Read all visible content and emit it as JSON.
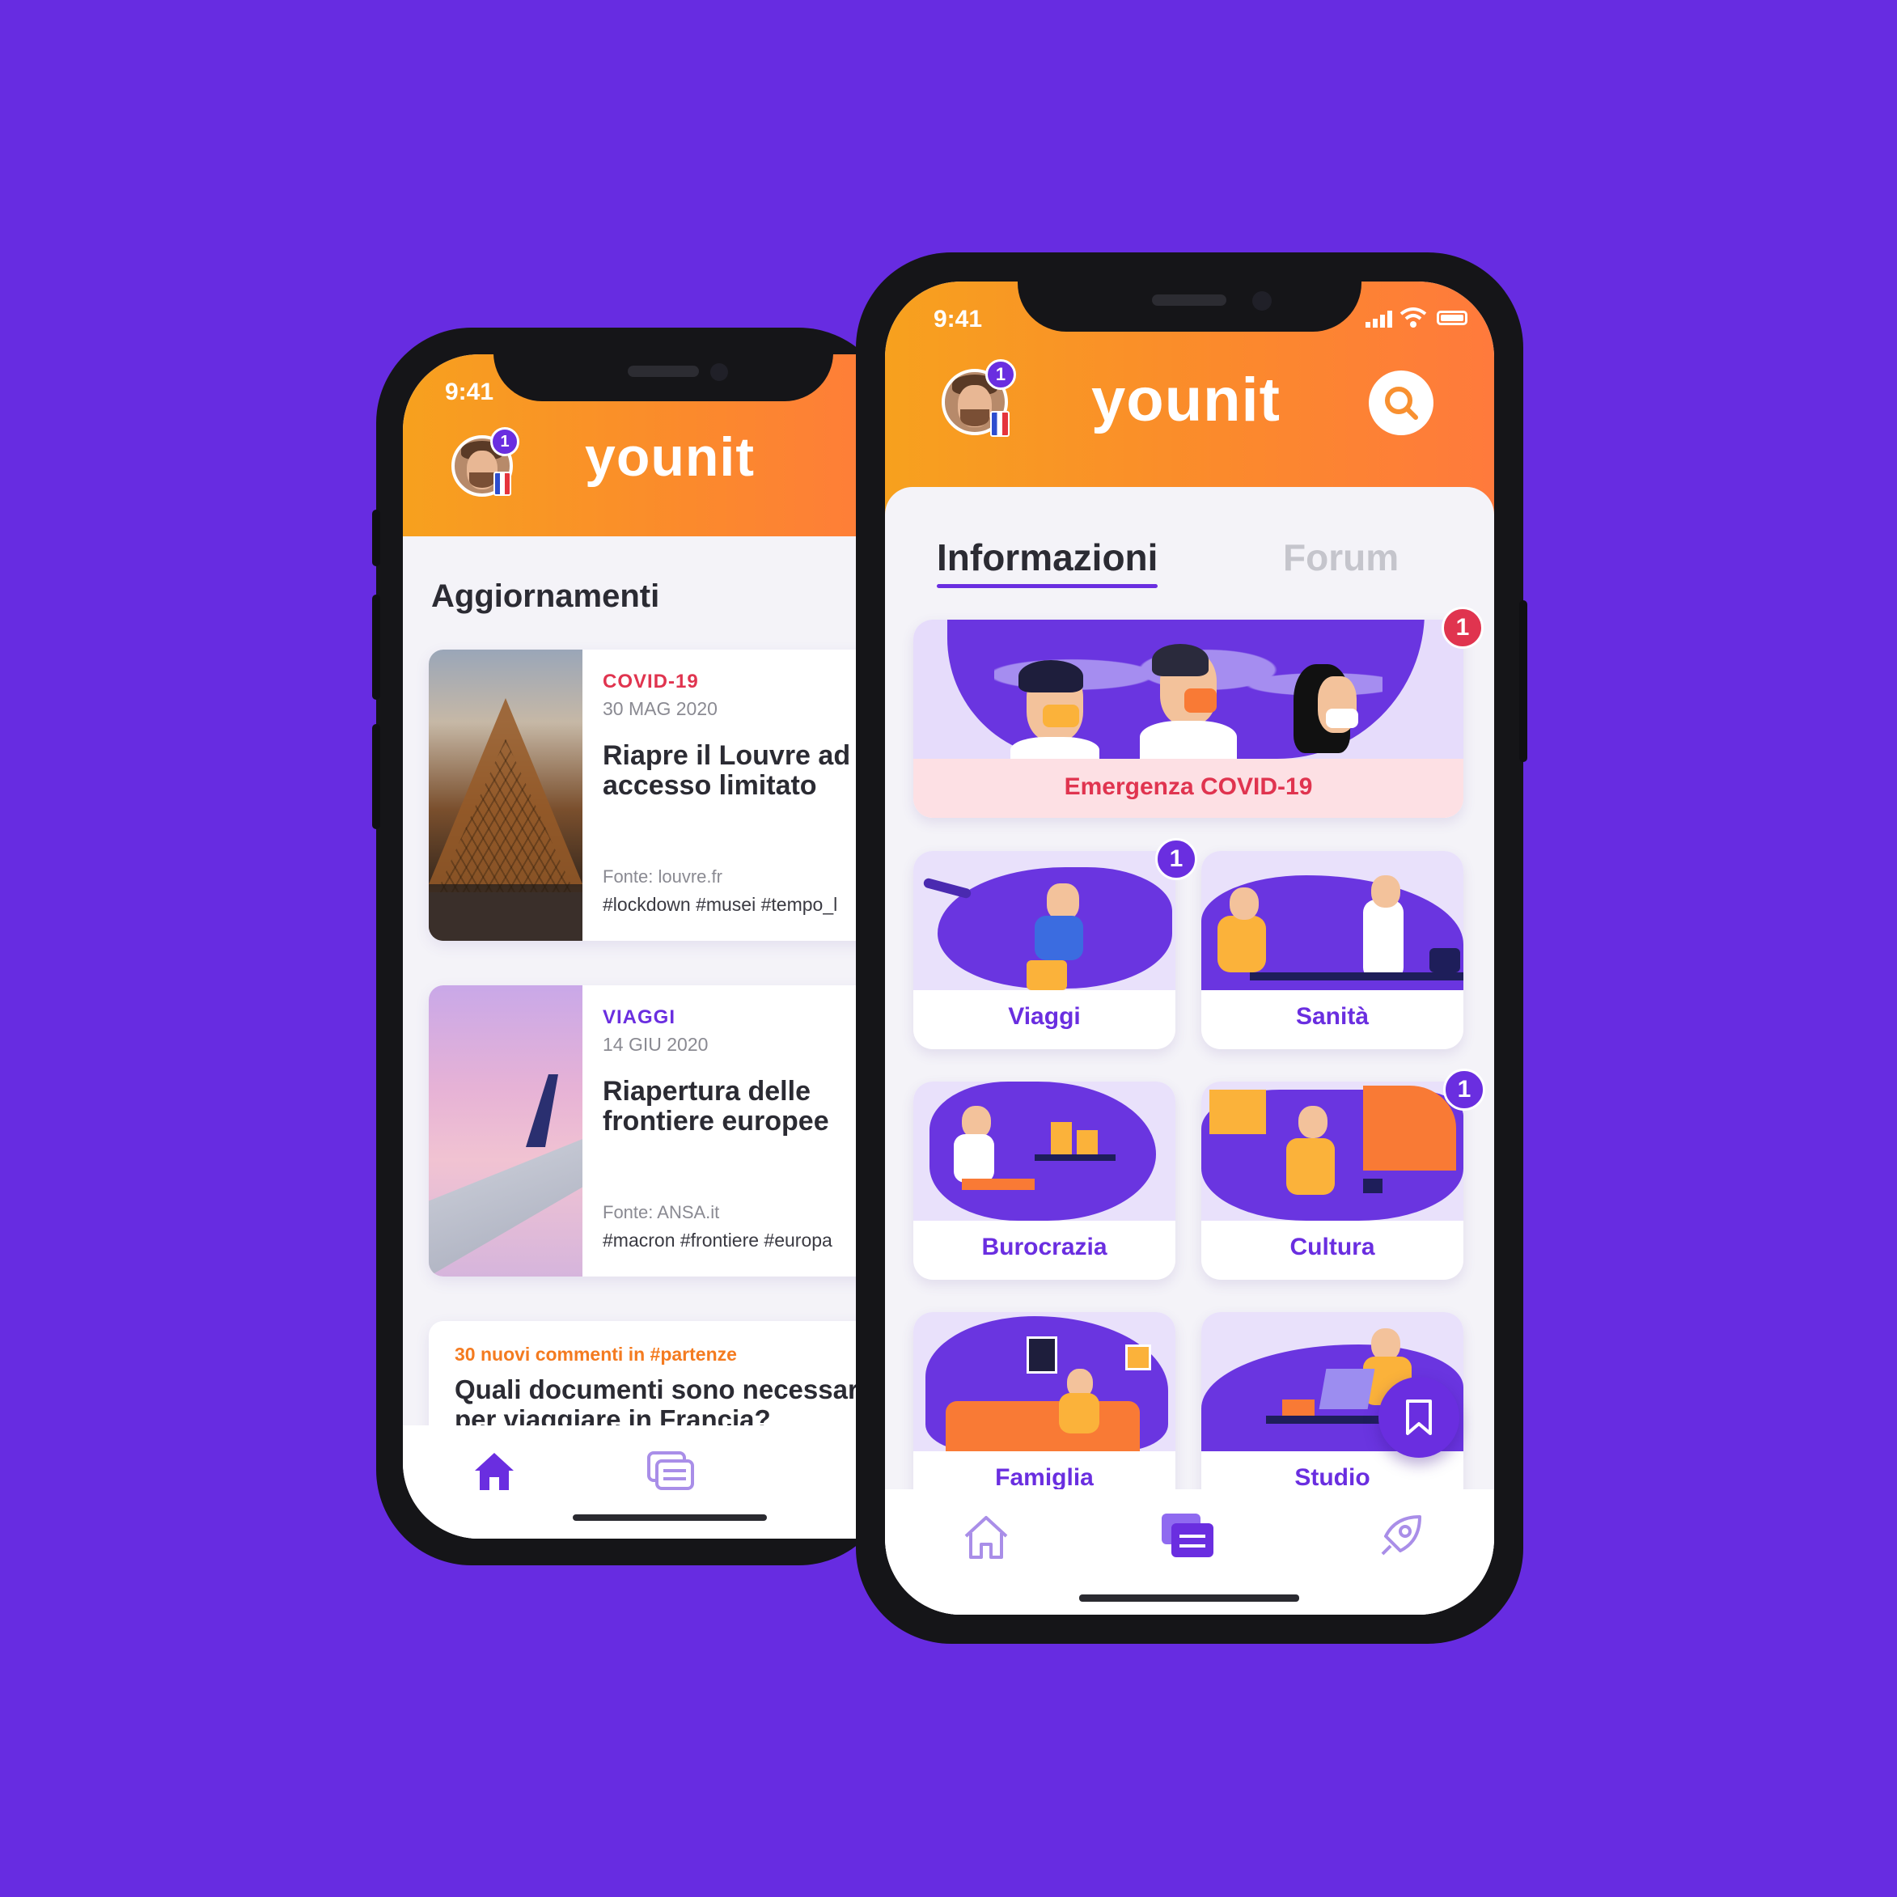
{
  "colors": {
    "background": "#672ce1",
    "header_gradient_start": "#f7a11e",
    "header_gradient_end": "#ff7a3c",
    "accent_purple": "#6a2ee0",
    "covid_red": "#e0344f",
    "forum_orange": "#f47b20"
  },
  "left_phone": {
    "status_time": "9:41",
    "logo": "younit",
    "avatar_badge": "1",
    "section_title": "Aggiornamenti",
    "news": [
      {
        "tag": "COVID-19",
        "date": "30 MAG 2020",
        "title_line1": "Riapre il Louvre ad",
        "title_line2": "accesso limitato",
        "source": "Fonte: louvre.fr",
        "hashtags": "#lockdown #musei #tempo_l"
      },
      {
        "tag": "VIAGGI",
        "date": "14 GIU 2020",
        "title_line1": "Riapertura delle",
        "title_line2": "frontiere europee",
        "source": "Fonte: ANSA.it",
        "hashtags": "#macron #frontiere #europa"
      }
    ],
    "forum_card": {
      "meta": "30 nuovi commenti in #partenze",
      "title_line1": "Quali documenti sono necessari",
      "title_line2": "per viaggiare in Francia?"
    },
    "nav_icons": [
      "home-icon",
      "chat-icon",
      "rocket-icon"
    ]
  },
  "right_phone": {
    "status_time": "9:41",
    "logo": "younit",
    "avatar_badge": "1",
    "tabs": [
      {
        "label": "Informazioni",
        "active": true
      },
      {
        "label": "Forum",
        "active": false
      }
    ],
    "covid_card": {
      "label": "Emergenza COVID-19",
      "badge": "1"
    },
    "categories": [
      {
        "label": "Viaggi",
        "badge": "1"
      },
      {
        "label": "Sanità",
        "badge": ""
      },
      {
        "label": "Burocrazia",
        "badge": ""
      },
      {
        "label": "Cultura",
        "badge": "1"
      },
      {
        "label": "Famiglia",
        "badge": ""
      },
      {
        "label": "Studio",
        "badge": ""
      }
    ],
    "nav_icons": [
      "home-icon",
      "chat-icon",
      "rocket-icon"
    ],
    "fab_icon": "bookmark-icon"
  }
}
